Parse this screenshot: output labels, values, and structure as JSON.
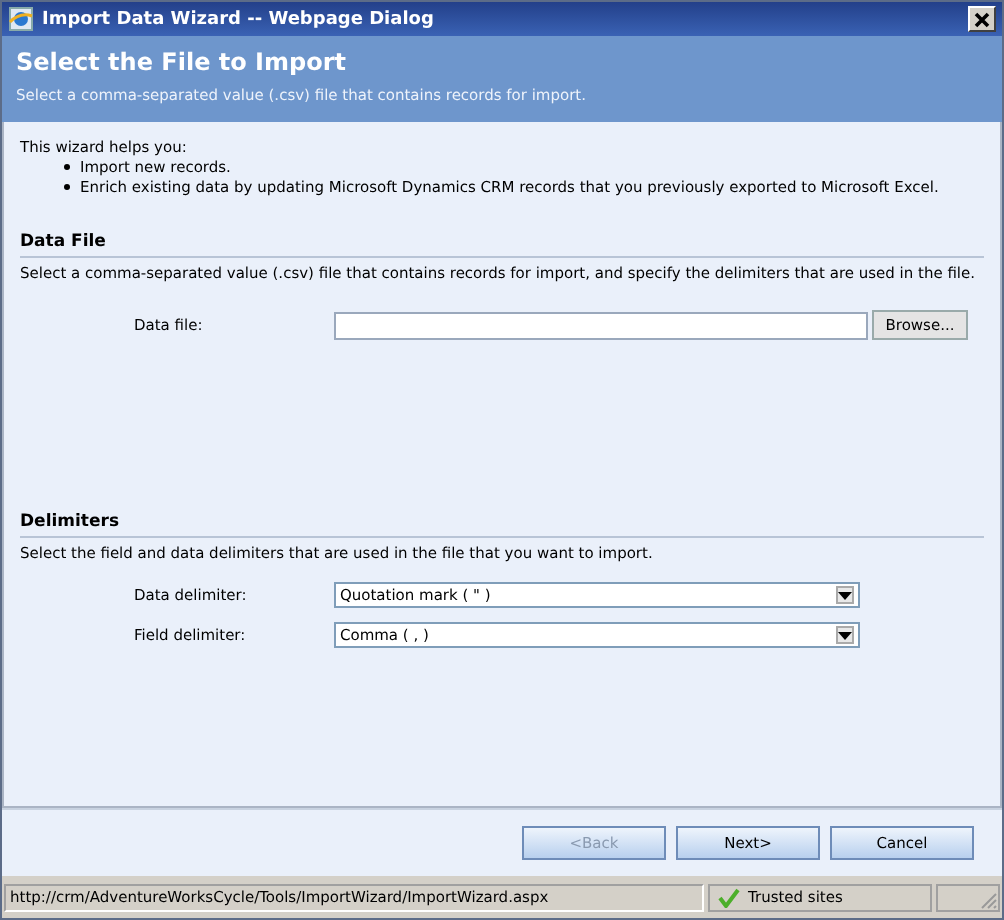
{
  "window": {
    "title": "Import Data Wizard -- Webpage Dialog"
  },
  "header": {
    "title": "Select the File to Import",
    "subtitle": "Select a comma-separated value (.csv) file that contains records for import."
  },
  "intro": {
    "text": "This wizard helps you:",
    "bullets": [
      "Import new records.",
      "Enrich existing data by updating Microsoft Dynamics CRM records that you previously exported to Microsoft Excel."
    ]
  },
  "sections": [
    {
      "title": "Data File",
      "description": "Select a comma-separated value (.csv) file that contains records for import, and specify the delimiters that are used in the file.",
      "fields": [
        {
          "kind": "file",
          "label": "Data file:",
          "button": "Browse..."
        }
      ]
    },
    {
      "title": "Delimiters",
      "description": "Select the field and data delimiters that are used in the file that you want to import.",
      "fields": [
        {
          "kind": "select",
          "label": "Data delimiter:",
          "value": "Quotation mark ( \" )"
        },
        {
          "kind": "select",
          "label": "Field delimiter:",
          "value": "Comma ( , )"
        }
      ]
    }
  ],
  "buttons": [
    {
      "label": "<Back",
      "disabled": true
    },
    {
      "label": "Next>",
      "disabled": false
    },
    {
      "label": "Cancel",
      "disabled": false
    }
  ],
  "status_bar": {
    "url": "http://crm/AdventureWorksCycle/Tools/ImportWizard/ImportWizard.aspx",
    "zone": "Trusted sites"
  }
}
